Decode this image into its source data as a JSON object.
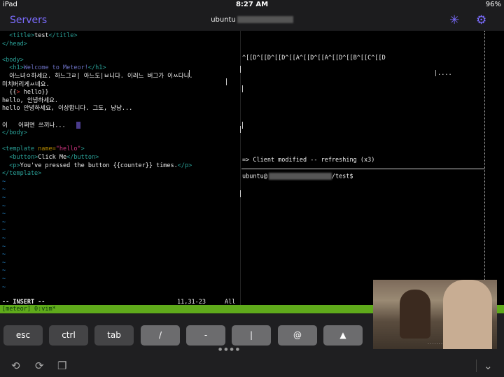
{
  "status": {
    "device": "iPad",
    "time": "8:27 AM",
    "battery": "96%"
  },
  "nav": {
    "back_label": "Servers",
    "title": "ubuntu"
  },
  "editor": {
    "lines": [
      {
        "parts": [
          {
            "c": "txt",
            "t": "  "
          },
          {
            "c": "tag",
            "t": "<title>"
          },
          {
            "c": "txt",
            "t": "test"
          },
          {
            "c": "tag",
            "t": "</title>"
          }
        ]
      },
      {
        "parts": [
          {
            "c": "tag",
            "t": "</head>"
          }
        ]
      },
      {
        "parts": []
      },
      {
        "parts": [
          {
            "c": "tag",
            "t": "<body>"
          }
        ]
      },
      {
        "parts": [
          {
            "c": "txt",
            "t": "  "
          },
          {
            "c": "tag",
            "t": "<h1>"
          },
          {
            "c": "h1txt",
            "t": "Welcome to Meteor!"
          },
          {
            "c": "tag",
            "t": "</h1>"
          }
        ]
      },
      {
        "parts": [
          {
            "c": "txt",
            "t": "  아느녀ㅇ하세요. 하느그ㄹ| 아느도|ㅂ니다. 이러느 버그가 이ㅆ다니."
          }
        ]
      },
      {
        "parts": [
          {
            "c": "txt",
            "t": "미치버리게ㅆ네요."
          }
        ]
      },
      {
        "parts": [
          {
            "c": "txt",
            "t": "  {{"
          },
          {
            "c": "brace",
            "t": ">"
          },
          {
            "c": "txt",
            "t": " hello}}"
          }
        ]
      },
      {
        "parts": [
          {
            "c": "txt",
            "t": "hello, 안녕하세요."
          }
        ]
      },
      {
        "parts": [
          {
            "c": "txt",
            "t": "hello 안녕하세요, 이상합니다. 그도, 냥냥..."
          }
        ]
      },
      {
        "parts": []
      },
      {
        "parts": [
          {
            "c": "txt",
            "t": "이   어쩌면 쓰끼나...   "
          },
          {
            "c": "cursor",
            "t": ""
          }
        ]
      },
      {
        "parts": [
          {
            "c": "tag",
            "t": "</body>"
          }
        ]
      },
      {
        "parts": []
      },
      {
        "parts": [
          {
            "c": "tag",
            "t": "<template "
          },
          {
            "c": "attr",
            "t": "name="
          },
          {
            "c": "str",
            "t": "\"hello\""
          },
          {
            "c": "tag",
            "t": ">"
          }
        ]
      },
      {
        "parts": [
          {
            "c": "txt",
            "t": "  "
          },
          {
            "c": "tag",
            "t": "<button>"
          },
          {
            "c": "txt",
            "t": "Click Me"
          },
          {
            "c": "tag",
            "t": "</button>"
          }
        ]
      },
      {
        "parts": [
          {
            "c": "txt",
            "t": "  "
          },
          {
            "c": "tag",
            "t": "<p>"
          },
          {
            "c": "txt",
            "t": "You've pressed the button {{counter}} times."
          },
          {
            "c": "tag",
            "t": "</p>"
          }
        ]
      },
      {
        "parts": [
          {
            "c": "tag",
            "t": "</template>"
          }
        ]
      }
    ],
    "tildes": 14,
    "mode": "-- INSERT --",
    "position": "11,31-23",
    "scroll": "All"
  },
  "right_pane": {
    "escape_line": "^[[D^[[D^[[D^[[A^[[D^[[A^[[D^[[B^[[C^[[D",
    "dots_line": "|....",
    "refresh_line": "=> Client modified -- refreshing (x3)",
    "prompt_prefix": "ubuntu@",
    "prompt_suffix": "/test$"
  },
  "tmux": {
    "status": "[meteor] 0:vim*"
  },
  "keys": [
    {
      "label": "esc",
      "style": "dark",
      "name": "esc-key"
    },
    {
      "label": "ctrl",
      "style": "dark",
      "name": "ctrl-key"
    },
    {
      "label": "tab",
      "style": "dark",
      "name": "tab-key"
    },
    {
      "label": "/",
      "style": "light",
      "name": "slash-key"
    },
    {
      "label": "-",
      "style": "light",
      "name": "dash-key"
    },
    {
      "label": "|",
      "style": "light",
      "name": "pipe-key"
    },
    {
      "label": "@",
      "style": "light",
      "name": "at-key"
    },
    {
      "label": "▲",
      "style": "light",
      "name": "up-arrow-key"
    }
  ],
  "icons": {
    "undo": "undo-icon",
    "redo": "redo-icon",
    "copy": "copy-icon",
    "collapse": "chevron-down-icon",
    "brightness": "brightness-icon",
    "settings": "gear-icon"
  },
  "pip": {
    "subtitle": "· · · · · · ·"
  }
}
